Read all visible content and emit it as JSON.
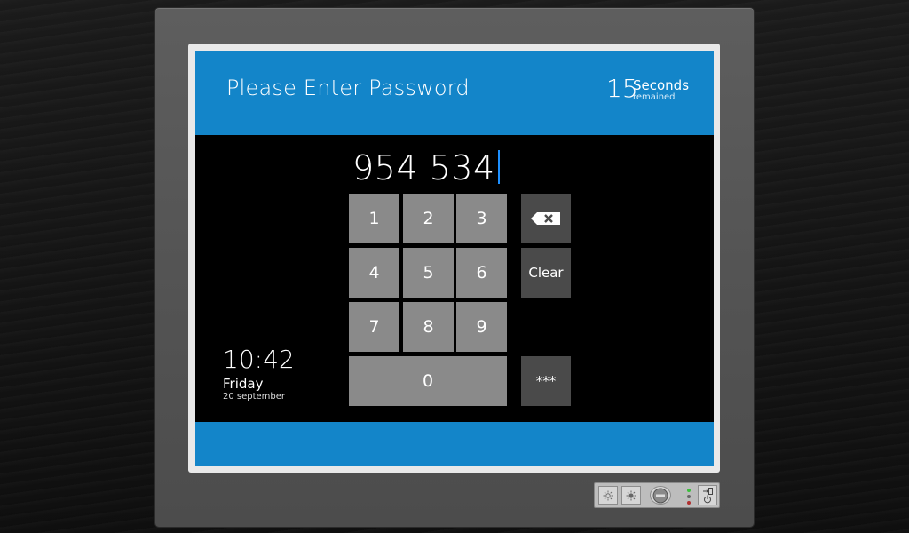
{
  "header": {
    "title": "Please Enter Password",
    "timer_value": "15",
    "timer_unit": "Seconds",
    "timer_sub": "remained"
  },
  "password": {
    "value": "954 534"
  },
  "keypad": {
    "keys": [
      "1",
      "2",
      "3",
      "4",
      "5",
      "6",
      "7",
      "8",
      "9",
      "0"
    ],
    "backspace_icon": "backspace-icon",
    "clear_label": "Clear",
    "mask_label": "***"
  },
  "clock": {
    "time": "10:42",
    "day": "Friday",
    "date": "20 september"
  },
  "colors": {
    "accent": "#1385c9",
    "key": "#8a8a8a",
    "key_dark": "#4a4a4a",
    "cursor": "#1e90ff"
  },
  "hardware_panel": {
    "icons": [
      "brightness-down-icon",
      "brightness-up-icon",
      "logo-icon",
      "login-icon",
      "power-icon"
    ]
  }
}
